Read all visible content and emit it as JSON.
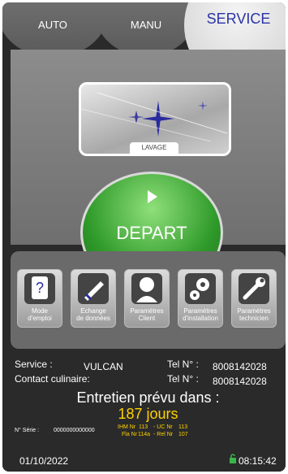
{
  "tabs": {
    "auto": "AUTO",
    "manu": "MANU",
    "service": "SERVICE"
  },
  "program": {
    "label": "LAVAGE"
  },
  "start_button": {
    "label": "DEPART"
  },
  "tools": [
    {
      "label_line1": "Mode",
      "label_line2": "d'emploi",
      "icon": "manual-icon"
    },
    {
      "label_line1": "Echange",
      "label_line2": "de données",
      "icon": "data-exchange-icon"
    },
    {
      "label_line1": "Paramètres",
      "label_line2": "Client",
      "icon": "user-icon"
    },
    {
      "label_line1": "Paramètres",
      "label_line2": "d'installation",
      "icon": "gears-icon"
    },
    {
      "label_line1": "Paramètres",
      "label_line2": "technicien",
      "icon": "wrench-icon"
    }
  ],
  "info": {
    "service_label": "Service :",
    "service_value": "VULCAN",
    "tel1_label": "Tel N° :",
    "tel1_value": "8008142028",
    "contact_label": "Contact culinaire:",
    "tel2_label": "Tel N° :",
    "tel2_value": "8008142028",
    "maintenance_label": "Entretien prévu dans :",
    "maintenance_days": "187 jours",
    "serial_label": "N° Série :",
    "serial_value": "0000000000000",
    "ihm_label": "IHM Nr",
    "ihm_value": "113",
    "uc_label": "- UC Nr",
    "uc_value": "113",
    "fla_label": "Fla Nr",
    "fla_value": "114a",
    "rel_label": "- Rel Nr",
    "rel_value": "107"
  },
  "footer": {
    "date": "01/10/2022",
    "time": "08:15:42"
  }
}
